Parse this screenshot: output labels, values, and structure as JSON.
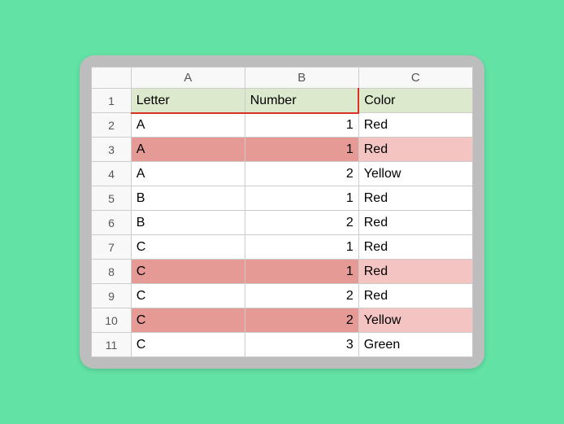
{
  "columns": [
    "A",
    "B",
    "C"
  ],
  "header_row": {
    "letter": "Letter",
    "number": "Number",
    "color": "Color"
  },
  "rows": [
    {
      "n": "1"
    },
    {
      "n": "2",
      "letter": "A",
      "number": "1",
      "color": "Red",
      "hl": false
    },
    {
      "n": "3",
      "letter": "A",
      "number": "1",
      "color": "Red",
      "hl": true
    },
    {
      "n": "4",
      "letter": "A",
      "number": "2",
      "color": "Yellow",
      "hl": false
    },
    {
      "n": "5",
      "letter": "B",
      "number": "1",
      "color": "Red",
      "hl": false
    },
    {
      "n": "6",
      "letter": "B",
      "number": "2",
      "color": "Red",
      "hl": false
    },
    {
      "n": "7",
      "letter": "C",
      "number": "1",
      "color": "Red",
      "hl": false
    },
    {
      "n": "8",
      "letter": "C",
      "number": "1",
      "color": "Red",
      "hl": true
    },
    {
      "n": "9",
      "letter": "C",
      "number": "2",
      "color": "Red",
      "hl": false
    },
    {
      "n": "10",
      "letter": "C",
      "number": "2",
      "color": "Yellow",
      "hl": true
    },
    {
      "n": "11",
      "letter": "C",
      "number": "3",
      "color": "Green",
      "hl": false
    }
  ],
  "chart_data": {
    "type": "table",
    "columns": [
      "Letter",
      "Number",
      "Color"
    ],
    "rows": [
      [
        "A",
        1,
        "Red"
      ],
      [
        "A",
        1,
        "Red"
      ],
      [
        "A",
        2,
        "Yellow"
      ],
      [
        "B",
        1,
        "Red"
      ],
      [
        "B",
        2,
        "Red"
      ],
      [
        "C",
        1,
        "Red"
      ],
      [
        "C",
        1,
        "Red"
      ],
      [
        "C",
        2,
        "Red"
      ],
      [
        "C",
        2,
        "Yellow"
      ],
      [
        "C",
        3,
        "Green"
      ]
    ],
    "highlighted_row_indices": [
      1,
      6,
      8
    ]
  }
}
